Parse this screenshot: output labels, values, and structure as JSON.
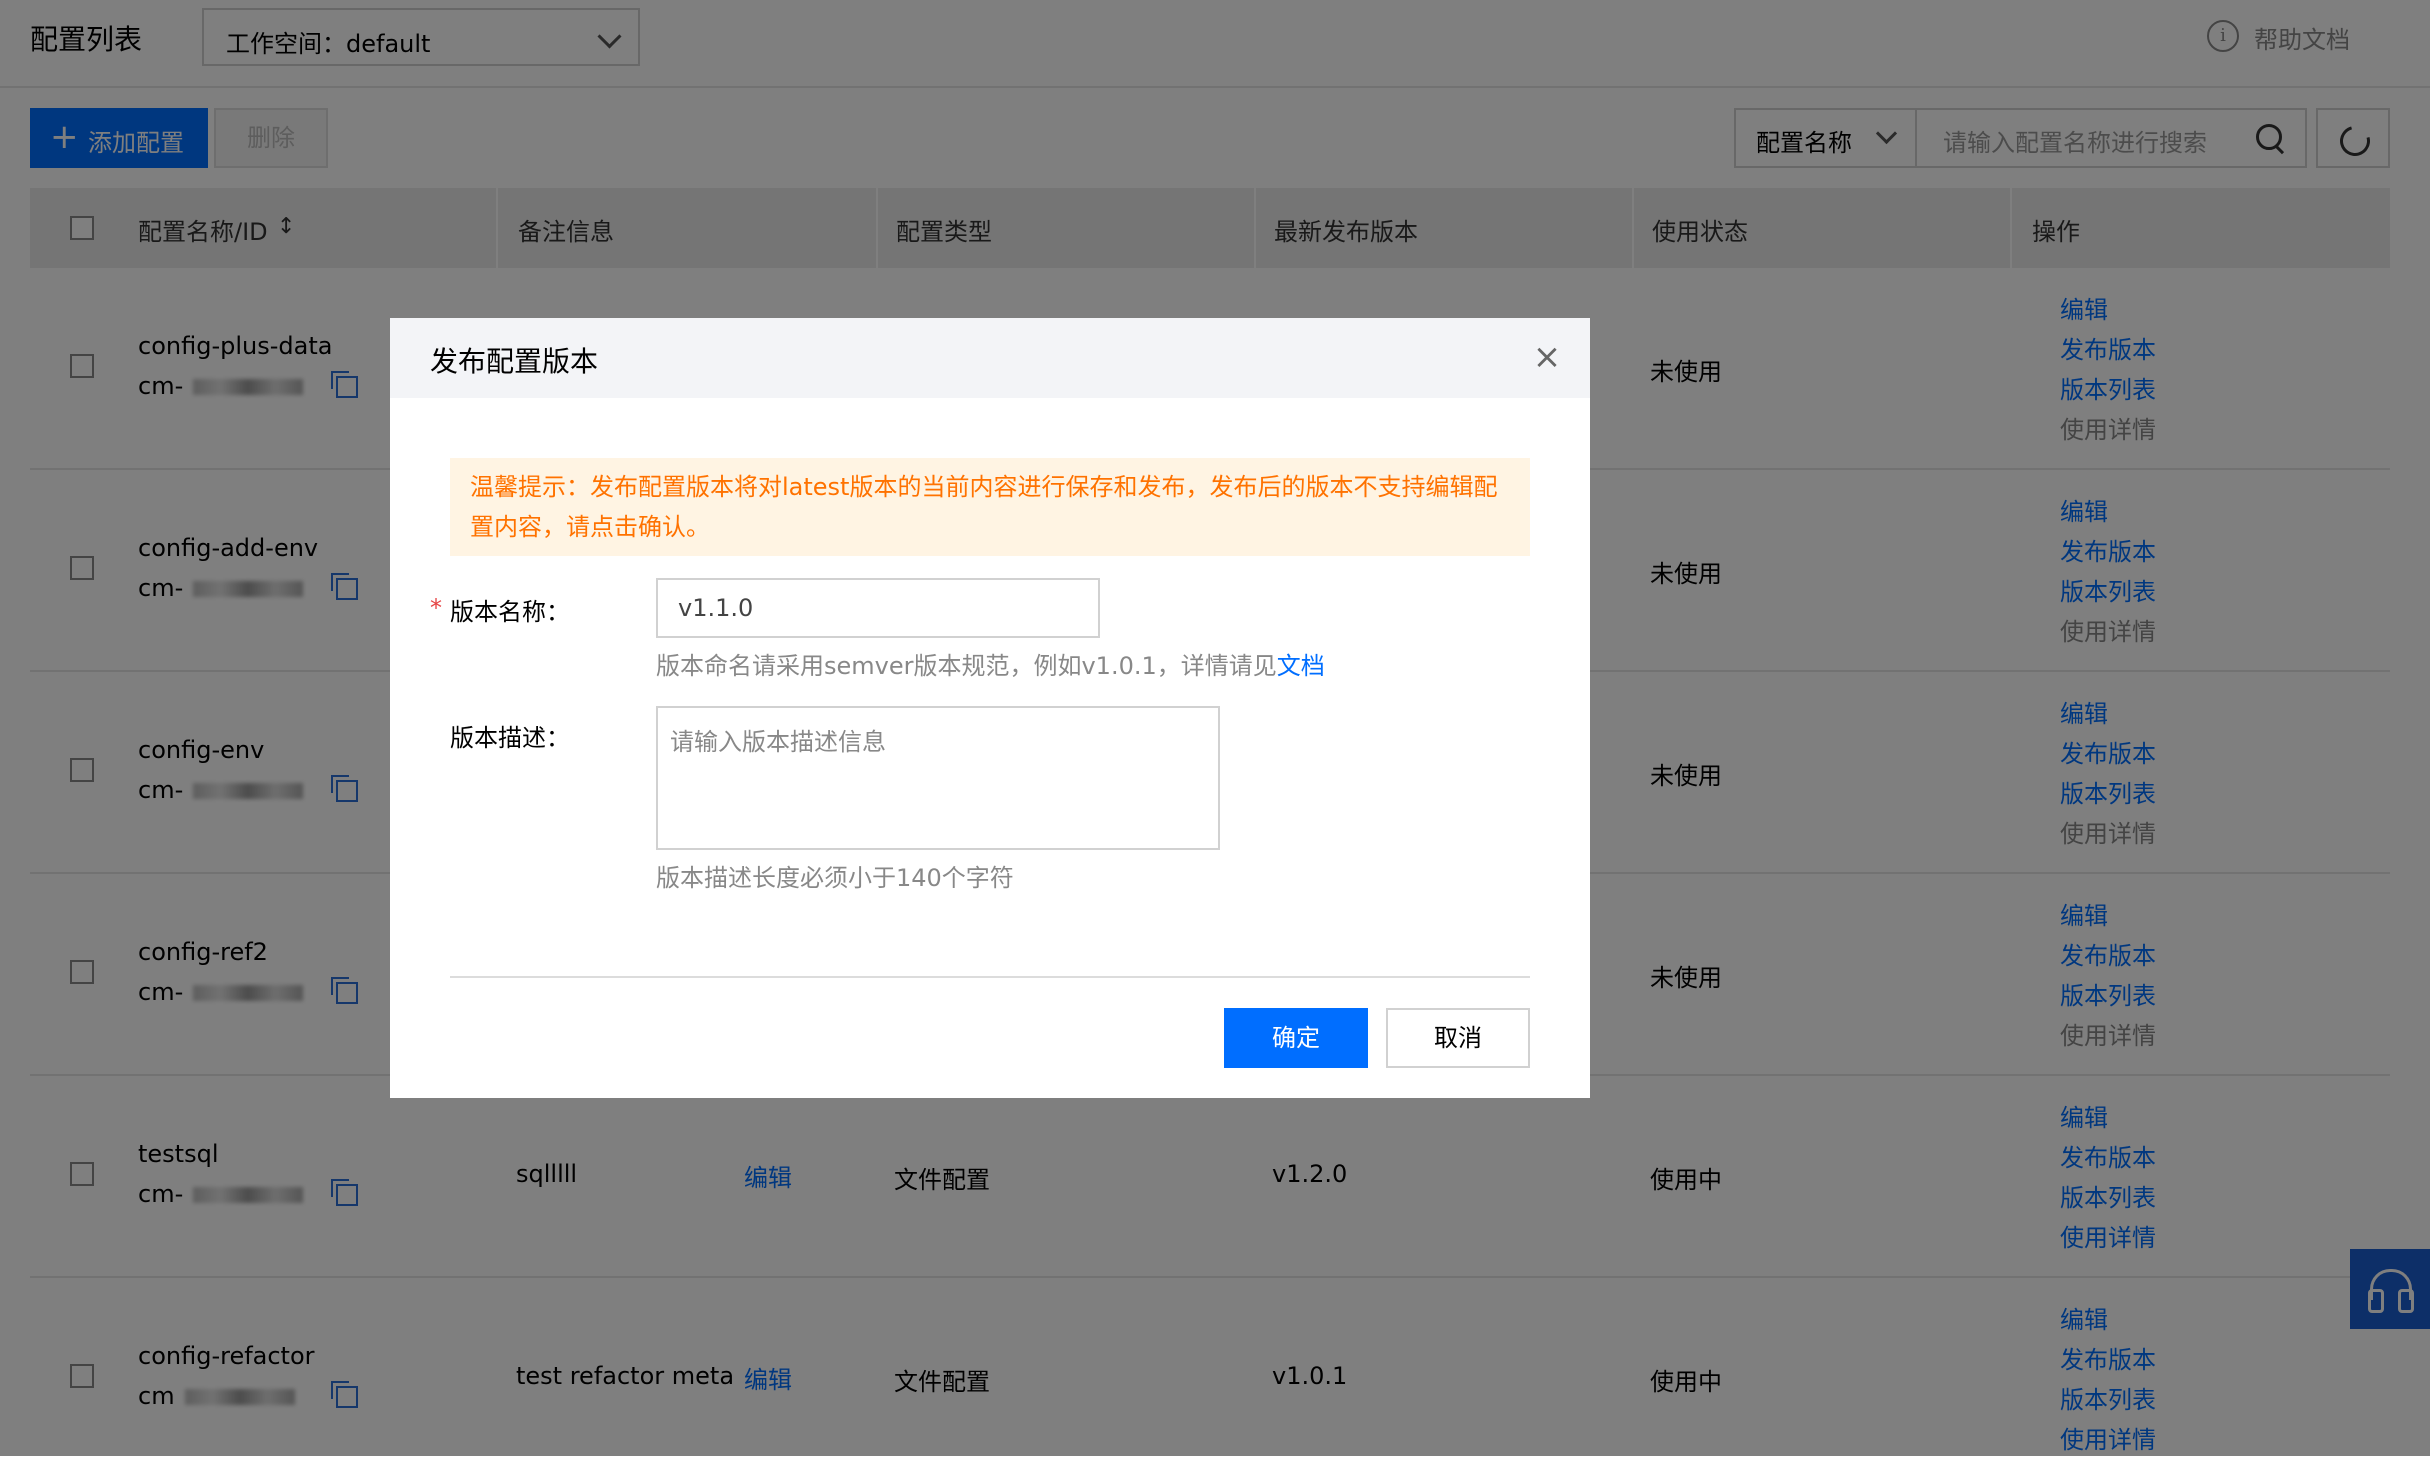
{
  "header": {
    "title": "配置列表",
    "workspace": "工作空间：default",
    "help": "帮助文档"
  },
  "toolbar": {
    "add_label": "添加配置",
    "delete_label": "删除",
    "filter_label": "配置名称",
    "search_placeholder": "请输入配置名称进行搜索"
  },
  "table": {
    "columns": [
      "配置名称/ID",
      "备注信息",
      "配置类型",
      "最新发布版本",
      "使用状态",
      "操作"
    ],
    "rows": [
      {
        "name": "config-plus-data",
        "id_prefix": "cm-",
        "remark": "",
        "edit": "",
        "type": "",
        "version": "",
        "status": "未使用",
        "ops": [
          "编辑",
          "发布版本",
          "版本列表",
          "使用详情"
        ]
      },
      {
        "name": "config-add-env",
        "id_prefix": "cm-",
        "remark": "",
        "edit": "",
        "type": "",
        "version": "",
        "status": "未使用",
        "ops": [
          "编辑",
          "发布版本",
          "版本列表",
          "使用详情"
        ]
      },
      {
        "name": "config-env",
        "id_prefix": "cm-",
        "remark": "",
        "edit": "",
        "type": "",
        "version": "",
        "status": "未使用",
        "ops": [
          "编辑",
          "发布版本",
          "版本列表",
          "使用详情"
        ]
      },
      {
        "name": "config-ref2",
        "id_prefix": "cm-",
        "remark": "",
        "edit": "",
        "type": "",
        "version": "",
        "status": "未使用",
        "ops": [
          "编辑",
          "发布版本",
          "版本列表",
          "使用详情"
        ]
      },
      {
        "name": "testsql",
        "id_prefix": "cm-",
        "remark": "sqlllll",
        "edit": "编辑",
        "type": "文件配置",
        "version": "v1.2.0",
        "status": "使用中",
        "ops": [
          "编辑",
          "发布版本",
          "版本列表",
          "使用详情"
        ]
      },
      {
        "name": "config-refactor",
        "id_prefix": "cm",
        "remark": "test refactor meta",
        "edit": "编辑",
        "type": "文件配置",
        "version": "v1.0.1",
        "status": "使用中",
        "ops": [
          "编辑",
          "发布版本",
          "版本列表",
          "使用详情"
        ]
      }
    ]
  },
  "modal": {
    "title": "发布配置版本",
    "tip": "温馨提示：发布配置版本将对latest版本的当前内容进行保存和发布，发布后的版本不支持编辑配置内容，请点击确认。",
    "required_mark": "*",
    "version_label": "版本名称：",
    "version_value": "v1.1.0",
    "version_hint": "版本命名请采用semver版本规范，例如v1.0.1，详情请见",
    "version_hint_link": "文档",
    "desc_label": "版本描述：",
    "desc_placeholder": "请输入版本描述信息",
    "desc_hint": "版本描述长度必须小于140个字符",
    "ok_label": "确定",
    "cancel_label": "取消"
  },
  "colors": {
    "primary": "#006eff",
    "warning_text": "#ff7200",
    "warning_bg": "#fff4e3"
  }
}
